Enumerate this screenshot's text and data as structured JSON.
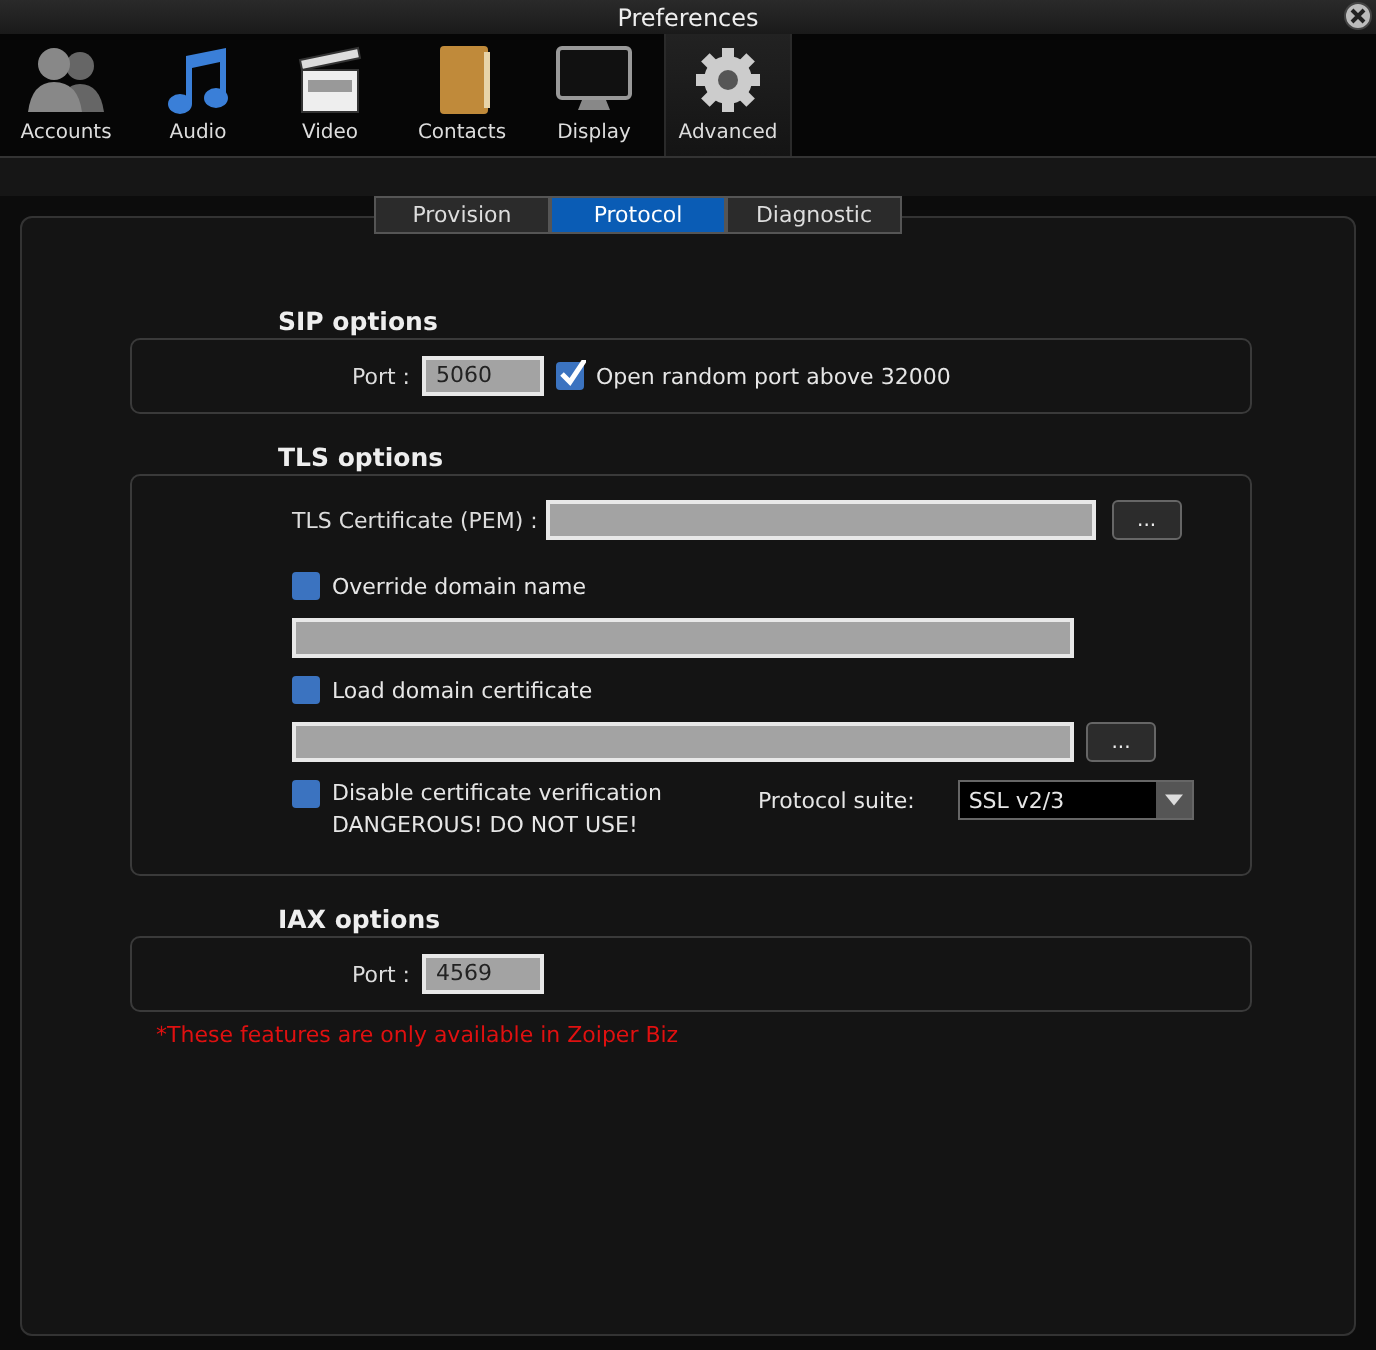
{
  "window": {
    "title": "Preferences"
  },
  "toolbar": [
    {
      "label": "Accounts",
      "kind": "accounts",
      "selected": false
    },
    {
      "label": "Audio",
      "kind": "audio",
      "selected": false
    },
    {
      "label": "Video",
      "kind": "video",
      "selected": false
    },
    {
      "label": "Contacts",
      "kind": "contacts",
      "selected": false
    },
    {
      "label": "Display",
      "kind": "display",
      "selected": false
    },
    {
      "label": "Advanced",
      "kind": "advanced",
      "selected": true
    }
  ],
  "tabs": [
    {
      "label": "Provision",
      "selected": false
    },
    {
      "label": "Protocol",
      "selected": true
    },
    {
      "label": "Diagnostic",
      "selected": false
    }
  ],
  "sip": {
    "heading": "SIP options",
    "port_label": "Port :",
    "port_value": "5060",
    "random_port": {
      "label": "Open random port above 32000",
      "checked": true
    }
  },
  "tls": {
    "heading": "TLS options",
    "cert_label": "TLS Certificate (PEM) :",
    "browse": "...",
    "override": {
      "label": "Override domain name",
      "checked": false
    },
    "load": {
      "label": "Load domain certificate",
      "checked": false
    },
    "load_browse": "...",
    "disable": {
      "label": "Disable certificate verification",
      "warning": "DANGEROUS! DO NOT USE!",
      "checked": false
    },
    "suite_label": "Protocol suite:",
    "suite_value": "SSL v2/3"
  },
  "iax": {
    "heading": "IAX options",
    "port_label": "Port :",
    "port_value": "4569"
  },
  "note": "*These features are only available in Zoiper Biz"
}
